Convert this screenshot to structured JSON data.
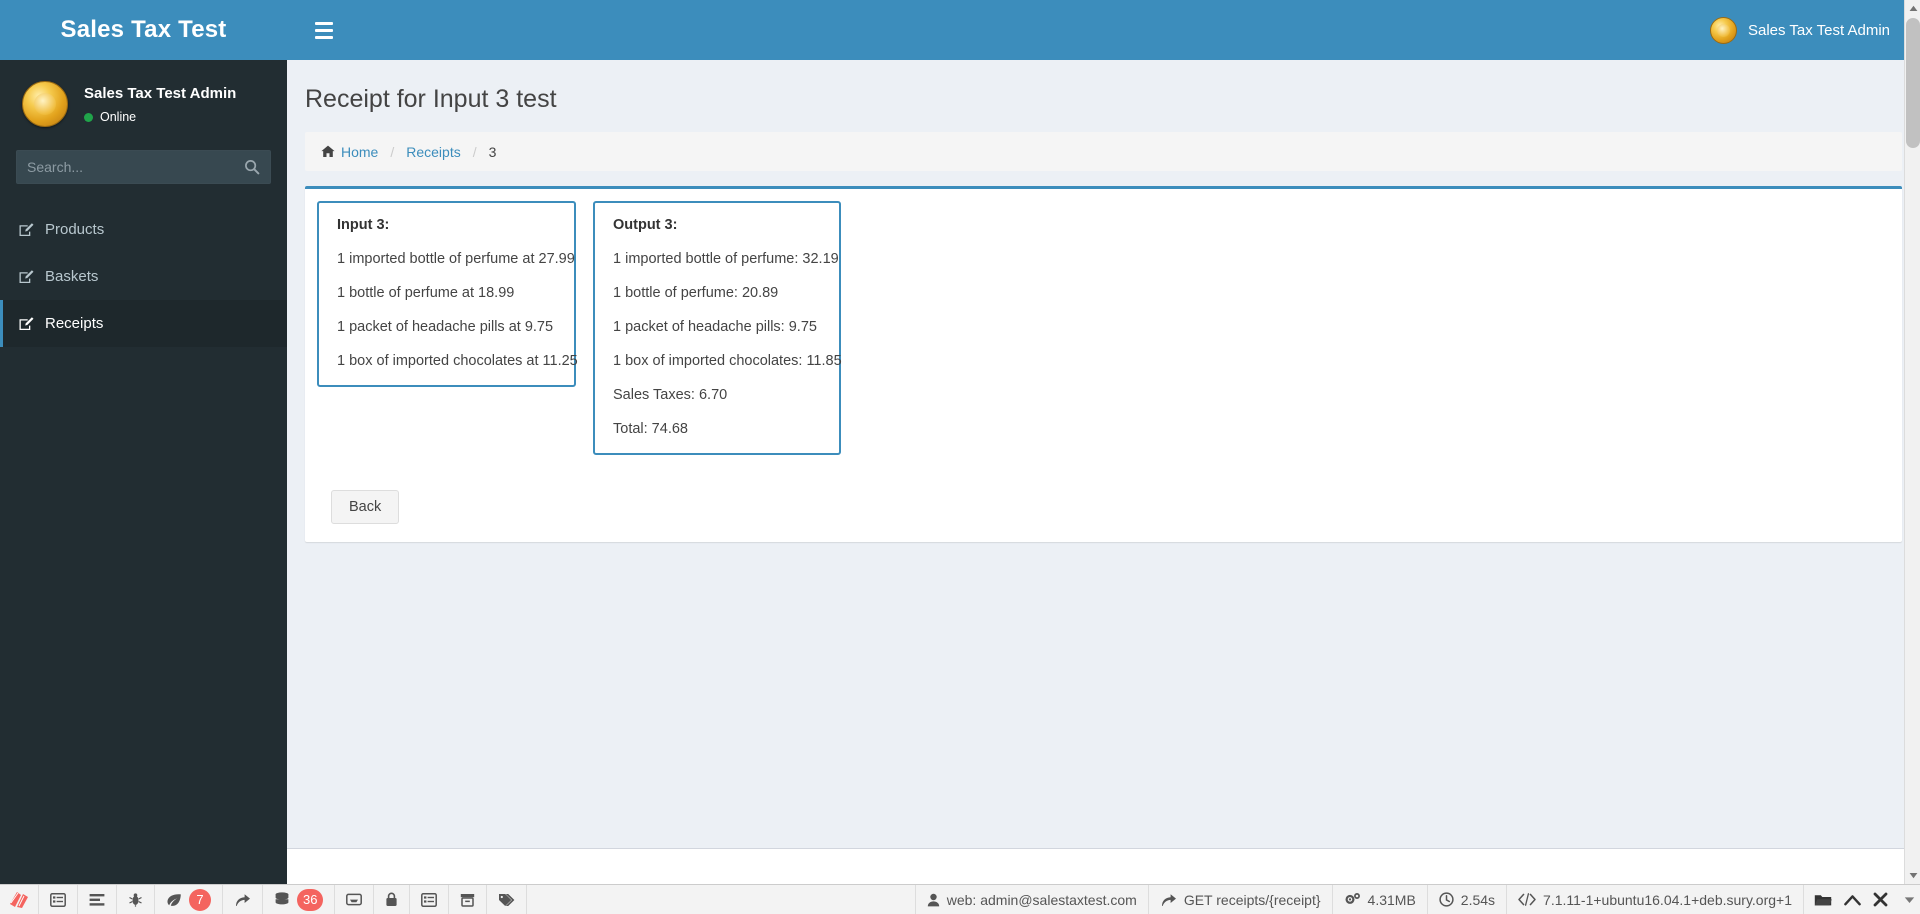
{
  "app": {
    "brand": "Sales Tax Test",
    "accent_color": "#3c8dbc",
    "sidebar_color": "#222d32"
  },
  "sidebar": {
    "user": {
      "name": "Sales Tax Test Admin",
      "status": "Online",
      "status_color": "#20a44a"
    },
    "search": {
      "placeholder": "Search...",
      "value": "",
      "icon": "search-icon"
    },
    "items": [
      {
        "label": "Products",
        "icon": "pencil-square-icon",
        "active": false
      },
      {
        "label": "Baskets",
        "icon": "pencil-square-icon",
        "active": false
      },
      {
        "label": "Receipts",
        "icon": "pencil-square-icon",
        "active": true
      }
    ]
  },
  "navbar": {
    "toggle_icon": "hamburger-icon",
    "user_name": "Sales Tax Test Admin",
    "avatar_icon": "coin-avatar-icon"
  },
  "content": {
    "page_title": "Receipt for Input 3 test",
    "breadcrumb": {
      "home_icon": "home-icon",
      "home": "Home",
      "sep1": "/",
      "section": "Receipts",
      "sep2": "/",
      "current": "3"
    },
    "input_panel": {
      "title": "Input 3:",
      "lines": [
        "1 imported bottle of perfume at 27.99",
        "1 bottle of perfume at 18.99",
        "1 packet of headache pills at 9.75",
        "1 box of imported chocolates at 11.25"
      ]
    },
    "output_panel": {
      "title": "Output 3:",
      "lines": [
        "1 imported bottle of perfume: 32.19",
        "1 bottle of perfume: 20.89",
        "1 packet of headache pills: 9.75",
        "1 box of imported chocolates: 11.85",
        "Sales Taxes: 6.70",
        "Total: 74.68"
      ]
    },
    "back_button": "Back"
  },
  "debugbar": {
    "logo_icon": "laravel-debugbar-logo-icon",
    "items": [
      {
        "icon": "messages-icon",
        "label": "",
        "badge": ""
      },
      {
        "icon": "list-view-icon",
        "label": "",
        "badge": ""
      },
      {
        "icon": "bug-icon",
        "label": "",
        "badge": ""
      },
      {
        "icon": "leaf-icon",
        "label": "",
        "badge": "7"
      },
      {
        "icon": "route-arrow-icon",
        "label": "",
        "badge": ""
      },
      {
        "icon": "database-icon",
        "label": "",
        "badge": "36"
      },
      {
        "icon": "inbox-icon",
        "label": "",
        "badge": ""
      },
      {
        "icon": "lock-icon",
        "label": "",
        "badge": ""
      },
      {
        "icon": "session-icon",
        "label": "",
        "badge": ""
      },
      {
        "icon": "archive-icon",
        "label": "",
        "badge": ""
      },
      {
        "icon": "tags-icon",
        "label": "",
        "badge": ""
      }
    ],
    "status": [
      {
        "icon": "user-icon",
        "label": "web: admin@salestaxtest.com"
      },
      {
        "icon": "route-arrow-icon",
        "label": "GET receipts/{receipt}"
      },
      {
        "icon": "gears-icon",
        "label": "4.31MB"
      },
      {
        "icon": "clock-icon",
        "label": "2.54s"
      },
      {
        "icon": "code-icon",
        "label": "7.1.11-1+ubuntu16.04.1+deb.sury.org+1"
      }
    ],
    "controls": [
      {
        "icon": "folder-open-icon"
      },
      {
        "icon": "chevron-up-icon"
      },
      {
        "icon": "close-icon"
      }
    ],
    "caret_icon": "chevron-down-icon",
    "badge_color": "#f4645f"
  }
}
